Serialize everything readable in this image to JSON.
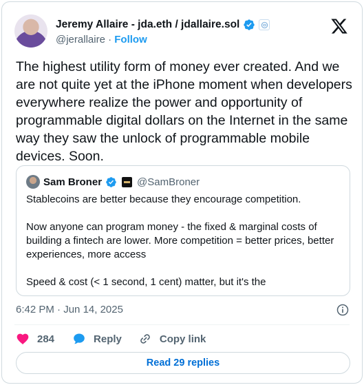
{
  "author": {
    "display_name": "Jeremy Allaire - jda.eth / jdallaire.sol",
    "handle": "@jerallaire",
    "separator": "·",
    "follow_label": "Follow"
  },
  "tweet": {
    "text": "The highest utility form of money ever created. And we are not quite yet at the iPhone moment when developers everywhere realize the power and opportunity of programmable digital dollars on the Internet in the same way they saw the unlock of programmable mobile devices. Soon.",
    "time": "6:42 PM",
    "date_separator": "·",
    "date": "Jun 14, 2025"
  },
  "quote": {
    "display_name": "Sam Broner",
    "handle": "@SamBroner",
    "paragraphs": [
      "Stablecoins are better because they encourage competition.",
      "Now anyone can program money - the fixed & marginal costs of building a fintech are lower. More competition = better prices, better experiences, more access",
      "Speed & cost (< 1 second, 1 cent) matter, but it's the"
    ]
  },
  "actions": {
    "like_count": "284",
    "reply_label": "Reply",
    "copy_label": "Copy link"
  },
  "read_replies_label": "Read 29 replies",
  "colors": {
    "accent": "#1d9bf0",
    "like": "#f91880",
    "muted": "#536471",
    "border": "#cfd9de"
  },
  "icons": [
    "x-logo-icon",
    "verified-badge-icon",
    "affiliate-badge-icon",
    "info-icon",
    "heart-icon",
    "reply-bubble-icon",
    "link-icon"
  ]
}
